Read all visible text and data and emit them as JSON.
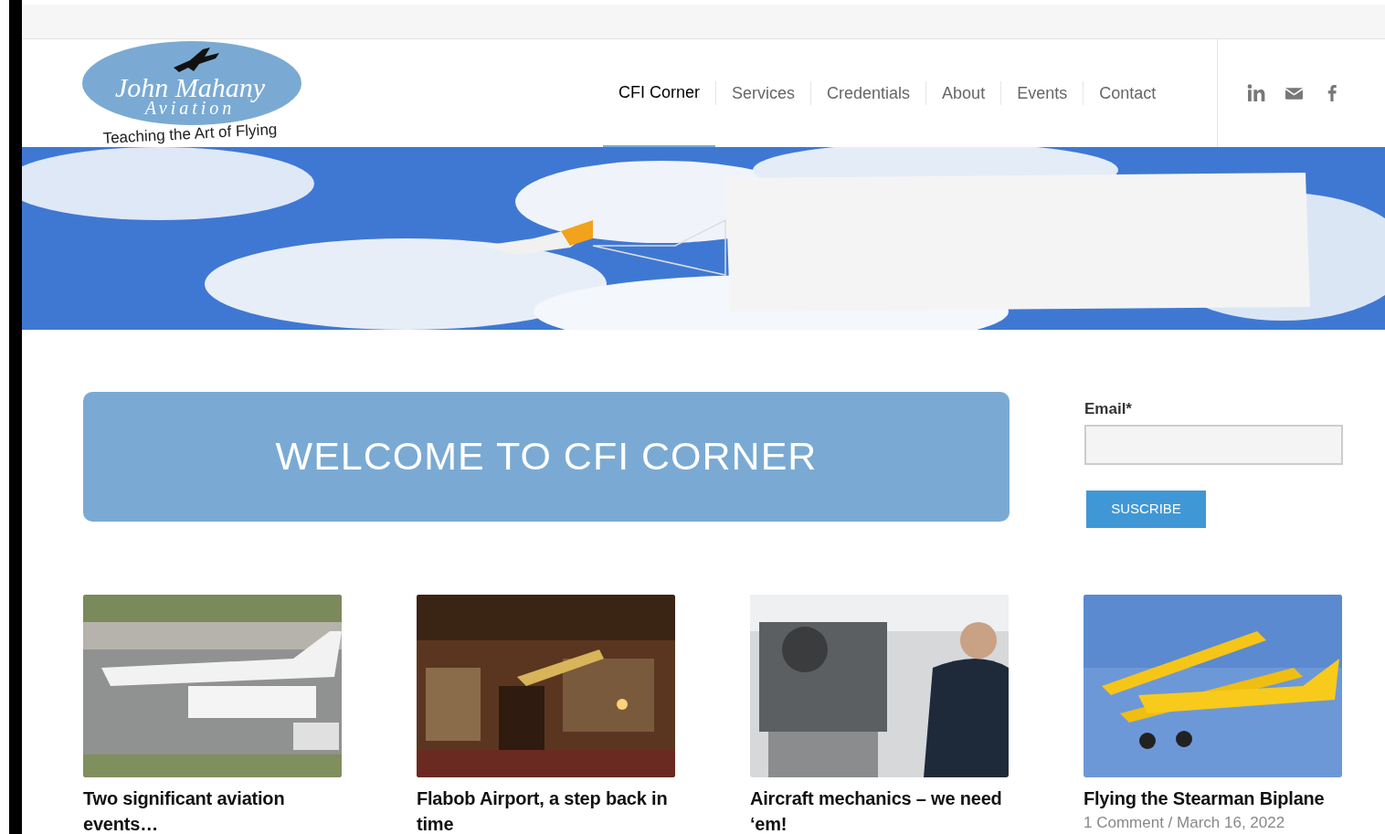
{
  "logo": {
    "name": "John Mahany",
    "subtitle": "Aviation",
    "tagline": "Teaching the Art of Flying"
  },
  "nav": [
    {
      "label": "CFI Corner",
      "selected": true
    },
    {
      "label": "Services",
      "selected": false
    },
    {
      "label": "Credentials",
      "selected": false
    },
    {
      "label": "About",
      "selected": false
    },
    {
      "label": "Events",
      "selected": false
    },
    {
      "label": "Contact",
      "selected": false
    }
  ],
  "social": [
    {
      "kind": "linkedin"
    },
    {
      "kind": "mail"
    },
    {
      "kind": "facebook"
    }
  ],
  "welcome": {
    "title": "WELCOME TO CFI CORNER"
  },
  "subscribe": {
    "label": "Email*",
    "button": "SUSCRIBE"
  },
  "posts": [
    {
      "title": "Two significant aviation events…"
    },
    {
      "title": "Flabob Airport, a step back in time"
    },
    {
      "title": "Aircraft mechanics – we need ‘em!"
    },
    {
      "title": "Flying the Stearman Biplane",
      "meta": "1 Comment / March 16, 2022"
    }
  ]
}
